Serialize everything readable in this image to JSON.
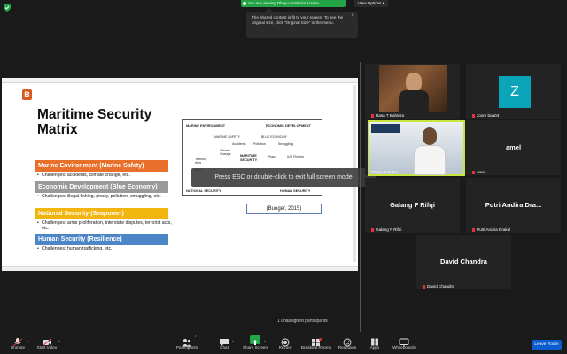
{
  "banner": {
    "share_text": "You are viewing Dhayu Santika's screen",
    "view_options": "View Options"
  },
  "tooltip": {
    "text": "The shared content is fit to your screen. To see the original size, click \"Original Size\" in the menu."
  },
  "slide": {
    "logo": "B",
    "title": "Maritime Security Matrix",
    "sections": [
      {
        "heading": "Marine Environment (Marine Safety)",
        "color": "#e8702a",
        "bullets": [
          "Challenges: accidents, climate change, etc."
        ]
      },
      {
        "heading": "Economic Development (Blue Economy)",
        "color": "#9a9a9a",
        "bullets": [
          "Challenges: illegal fishing, piracy, pollution, smuggling, etc."
        ]
      },
      {
        "heading": "National Security (Seapower)",
        "color": "#f2b50f",
        "bullets": [
          "Challenges: arms proliferation, interstate disputes, terrorist acts, etc."
        ]
      },
      {
        "heading": "Human Security (Resilience)",
        "color": "#4d86c6",
        "bullets": [
          "Challenges: human trafficking, etc."
        ]
      }
    ],
    "diagram": {
      "top_left": "MARINE ENVIRONMENT",
      "top_right": "ECONOMIC DEVELOPMENT",
      "marine_safety": "MARINE SAFETY",
      "blue_economy": "BLUE ECONOMY",
      "accidents": "Accidents",
      "pollution": "Pollution",
      "smuggling": "Smuggling",
      "climate_change": "Climate Change",
      "terrorist_acts": "Terrorist Acts",
      "center": "MARITIME SECURITY",
      "piracy": "Piracy",
      "iuu_fishing": "IUU Fishing",
      "arms": "Arms",
      "human": "Human",
      "bottom_left": "NATIONAL SECURITY",
      "bottom_right": "HUMAN SECURITY"
    },
    "citation": "(Bueger, 2015)",
    "esc_notice": "Press ESC or double-click to exit full screen mode"
  },
  "participants": [
    {
      "name": "Rasa T Bahtera",
      "type": "video"
    },
    {
      "name": "zoom baa04",
      "type": "avatar",
      "initial": "Z",
      "avatar_color": "#0aa5b8"
    },
    {
      "name": "Dhayu Santika",
      "type": "video-active"
    },
    {
      "name": "amel",
      "type": "name"
    },
    {
      "name": "Galang F Rifqi",
      "type": "name"
    },
    {
      "name": "Putri Andira Drakel",
      "type": "name",
      "display": "Putri Andira Dra..."
    },
    {
      "name": "David Chandra",
      "type": "name"
    }
  ],
  "unassigned": "1 unassigned participants",
  "toolbar": {
    "unmute": "Unmute",
    "start_video": "Start Video",
    "participants": "Participants",
    "participants_count": "7",
    "chat": "Chat",
    "share_screen": "Share Screen",
    "record": "Record",
    "breakout_rooms": "Breakout Rooms",
    "reactions": "Reactions",
    "apps": "Apps",
    "whiteboards": "Whiteboards",
    "leave": "Leave Room"
  }
}
